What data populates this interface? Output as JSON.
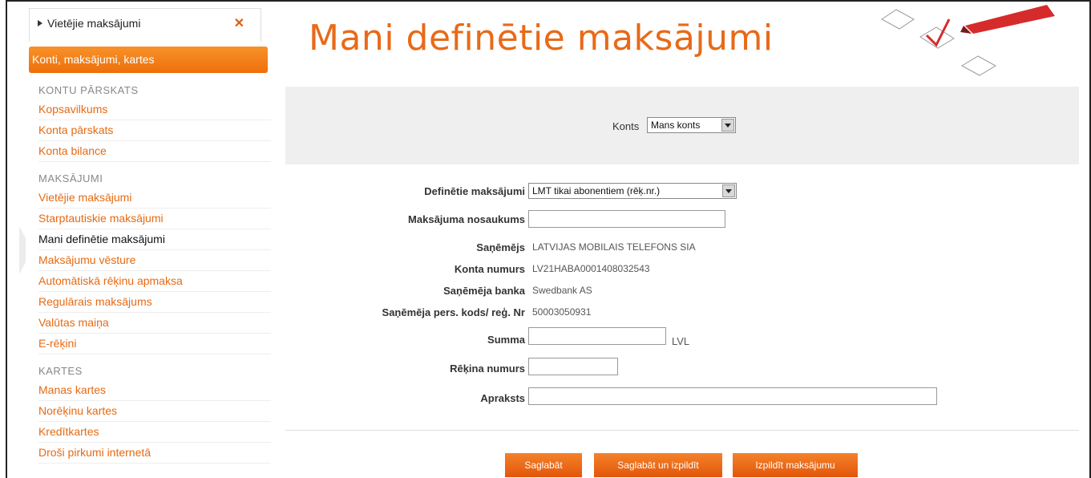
{
  "sidebar": {
    "active_tab": "Vietējie maksājumi",
    "section_title": "Konti, maksājumi, kartes",
    "groups": [
      {
        "title": "KONTU PĀRSKATS",
        "items": [
          "Kopsavilkums",
          "Konta pārskats",
          "Konta bilance"
        ]
      },
      {
        "title": "MAKSĀJUMI",
        "items": [
          "Vietējie maksājumi",
          "Starptautiskie maksājumi",
          "Mani definētie maksājumi",
          "Maksājumu vēsture",
          "Automātiskā rēķinu apmaksa",
          "Regulārais maksājums",
          "Valūtas maiņa",
          "E-rēķini"
        ]
      },
      {
        "title": "KARTES",
        "items": [
          "Manas kartes",
          "Norēķinu kartes",
          "Kredītkartes",
          "Droši pirkumi internetā"
        ]
      }
    ],
    "current_item": "Mani definētie maksājumi"
  },
  "page": {
    "title": "Mani definētie maksājumi"
  },
  "account": {
    "label": "Konts",
    "selected": "Mans konts"
  },
  "form": {
    "defined_label": "Definētie maksājumi",
    "defined_selected": "LMT tikai abonentiem (rēķ.nr.)",
    "name_label": "Maksājuma nosaukums",
    "name_value": "",
    "recipient_label": "Saņēmējs",
    "recipient_value": "LATVIJAS MOBILAIS TELEFONS SIA",
    "account_label": "Konta numurs",
    "account_value": "LV21HABA0001408032543",
    "bank_label": "Saņēmēja banka",
    "bank_value": "Swedbank AS",
    "code_label": "Saņēmēja pers. kods/ reģ. Nr",
    "code_value": "50003050931",
    "amount_label": "Summa",
    "amount_value": "",
    "currency": "LVL",
    "invoice_label": "Rēķina numurs",
    "invoice_value": "",
    "desc_label": "Apraksts",
    "desc_value": ""
  },
  "buttons": {
    "save": "Saglabāt",
    "save_execute": "Saglabāt un izpildīt",
    "execute": "Izpildīt maksājumu"
  },
  "colors": {
    "accent": "#e86a18",
    "button": "#e9661a",
    "panel": "#efefef"
  }
}
